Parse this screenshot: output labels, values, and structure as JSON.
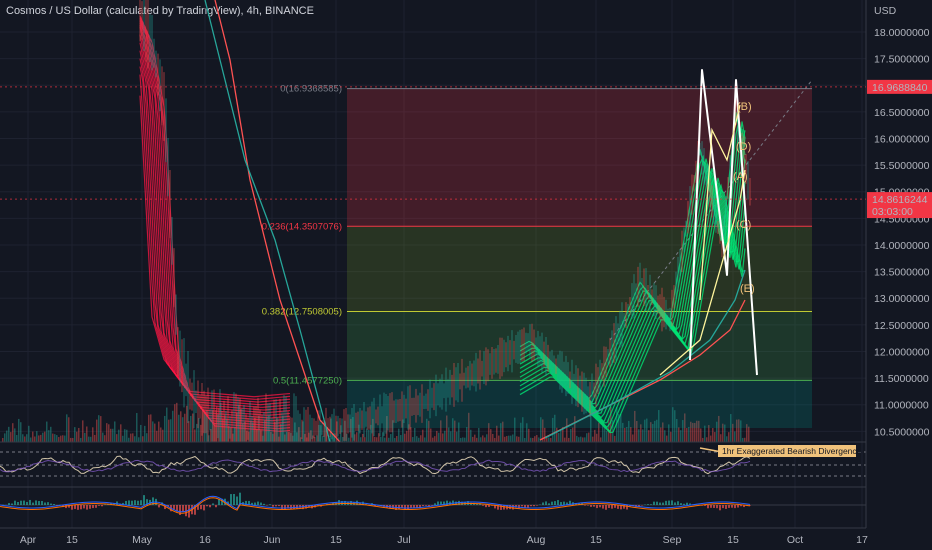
{
  "header": {
    "title": "Cosmos / US Dollar (calculated by TradingView), 4h, BINANCE",
    "currency": "USD"
  },
  "chart_data": {
    "type": "line",
    "y_axis": {
      "ticks": [
        "18.0000000",
        "17.5000000",
        "17.0000000",
        "16.5000000",
        "16.0000000",
        "15.5000000",
        "15.0000000",
        "14.5000000",
        "14.0000000",
        "13.5000000",
        "13.0000000",
        "12.5000000",
        "12.0000000",
        "11.5000000",
        "11.0000000",
        "10.5000000"
      ],
      "tick_values": [
        18.0,
        17.5,
        17.0,
        16.5,
        16.0,
        15.5,
        15.0,
        14.5,
        14.0,
        13.5,
        13.0,
        12.5,
        12.0,
        11.5,
        11.0,
        10.5
      ],
      "range": [
        10.3,
        18.6
      ]
    },
    "x_axis": {
      "labels": [
        "Apr",
        "15",
        "May",
        "16",
        "Jun",
        "15",
        "Jul",
        "Aug",
        "15",
        "Sep",
        "15",
        "Oct",
        "17"
      ]
    },
    "price_markers": [
      {
        "label": "16.9688840",
        "value": 16.968884,
        "color": "#f23645"
      },
      {
        "label": "14.8616244",
        "value": 14.8616244,
        "color": "#f23645",
        "sub": "03:03:00"
      }
    ],
    "fib_levels": [
      {
        "ratio_label": "0(16.9368585)",
        "value": 16.9368585,
        "color": "#787b86"
      },
      {
        "ratio_label": "0.236(14.3507076)",
        "value": 14.3507076,
        "color": "#f23645"
      },
      {
        "ratio_label": "0.382(12.7508005)",
        "value": 12.7508005,
        "color": "#c0ca33"
      },
      {
        "ratio_label": "0.5(11.4577250)",
        "value": 11.457725,
        "color": "#4caf50"
      }
    ],
    "wave_labels": [
      "(B)",
      "(D)",
      "(A)",
      "(C)",
      "(E)"
    ],
    "price_path": [
      [
        18.3,
        "Apr-late"
      ],
      [
        17.8,
        "May-start"
      ],
      [
        16.5,
        "May"
      ],
      [
        12.0,
        "May"
      ],
      [
        11.2,
        "May-16"
      ],
      [
        10.6,
        "Jun"
      ],
      [
        10.5,
        "Jul"
      ],
      [
        10.6,
        "Aug"
      ],
      [
        11.0,
        "Aug-15"
      ],
      [
        12.2,
        "Aug-late"
      ],
      [
        11.1,
        "Aug-end"
      ],
      [
        13.3,
        "Sep-start"
      ],
      [
        12.6,
        "Sep"
      ],
      [
        15.8,
        "Sep-8"
      ],
      [
        14.0,
        "Sep-12"
      ],
      [
        16.5,
        "Sep-15"
      ],
      [
        15.0,
        "Sep-17"
      ]
    ],
    "rsi": {
      "levels": [
        "50.00"
      ],
      "annotation": "1hr Exaggerated Bearish Divergence"
    },
    "macd": {
      "levels": [
        "0.0000000"
      ]
    }
  },
  "colors": {
    "background": "#131722",
    "bull": "#00e676",
    "bear": "#ff1744",
    "ma_red": "#ff5252",
    "ma_teal": "#26a69a",
    "pattern_line": "#ffffff",
    "rsi_line": "#d1c4a8"
  }
}
